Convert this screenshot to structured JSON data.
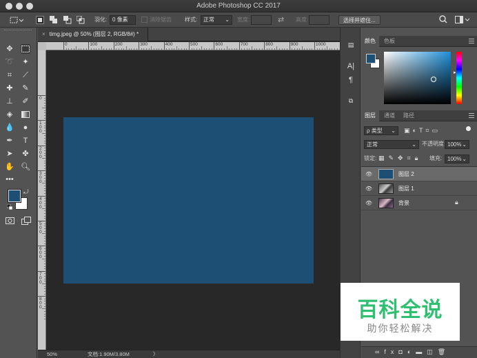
{
  "window": {
    "title": "Adobe Photoshop CC 2017"
  },
  "options_bar": {
    "feather_label": "羽化:",
    "feather_value": "0 像素",
    "antialias_label": "消除锯齿",
    "style_label": "样式:",
    "style_value": "正常",
    "width_label": "宽度:",
    "height_label": "高度:",
    "select_mask_button": "选择并遮住..."
  },
  "document": {
    "tab_title": "timg.jpeg @ 50% (图层 2, RGB/8#) *",
    "canvas_color": "#1d4f74",
    "ruler_h_ticks": [
      "0",
      "100",
      "200",
      "300",
      "400",
      "500",
      "600",
      "700",
      "800",
      "900",
      "1000"
    ],
    "ruler_v_ticks": [
      "0",
      "100",
      "200",
      "300",
      "400",
      "500",
      "600",
      "700",
      "800"
    ],
    "zoom": "50%",
    "doc_size": "文档:1.90M/3.80M",
    "arrow": "〉"
  },
  "color_panel": {
    "tabs": [
      "颜色",
      "色板"
    ],
    "foreground_color": "#1d4f74",
    "background_color": "#ffffff"
  },
  "layers_panel": {
    "tabs": [
      "图层",
      "通道",
      "路径"
    ],
    "filter_kind": "ρ 类型",
    "blend_mode": "正常",
    "opacity_label": "不透明度:",
    "opacity_value": "100%",
    "lock_label": "锁定:",
    "fill_label": "填充:",
    "fill_value": "100%",
    "layers": [
      {
        "name": "图层 2",
        "selected": true,
        "locked": false
      },
      {
        "name": "图层 1",
        "selected": false,
        "locked": false
      },
      {
        "name": "背景",
        "selected": false,
        "locked": true
      }
    ]
  },
  "watermark": {
    "title": "百科全说",
    "subtitle": "助你轻松解决"
  }
}
